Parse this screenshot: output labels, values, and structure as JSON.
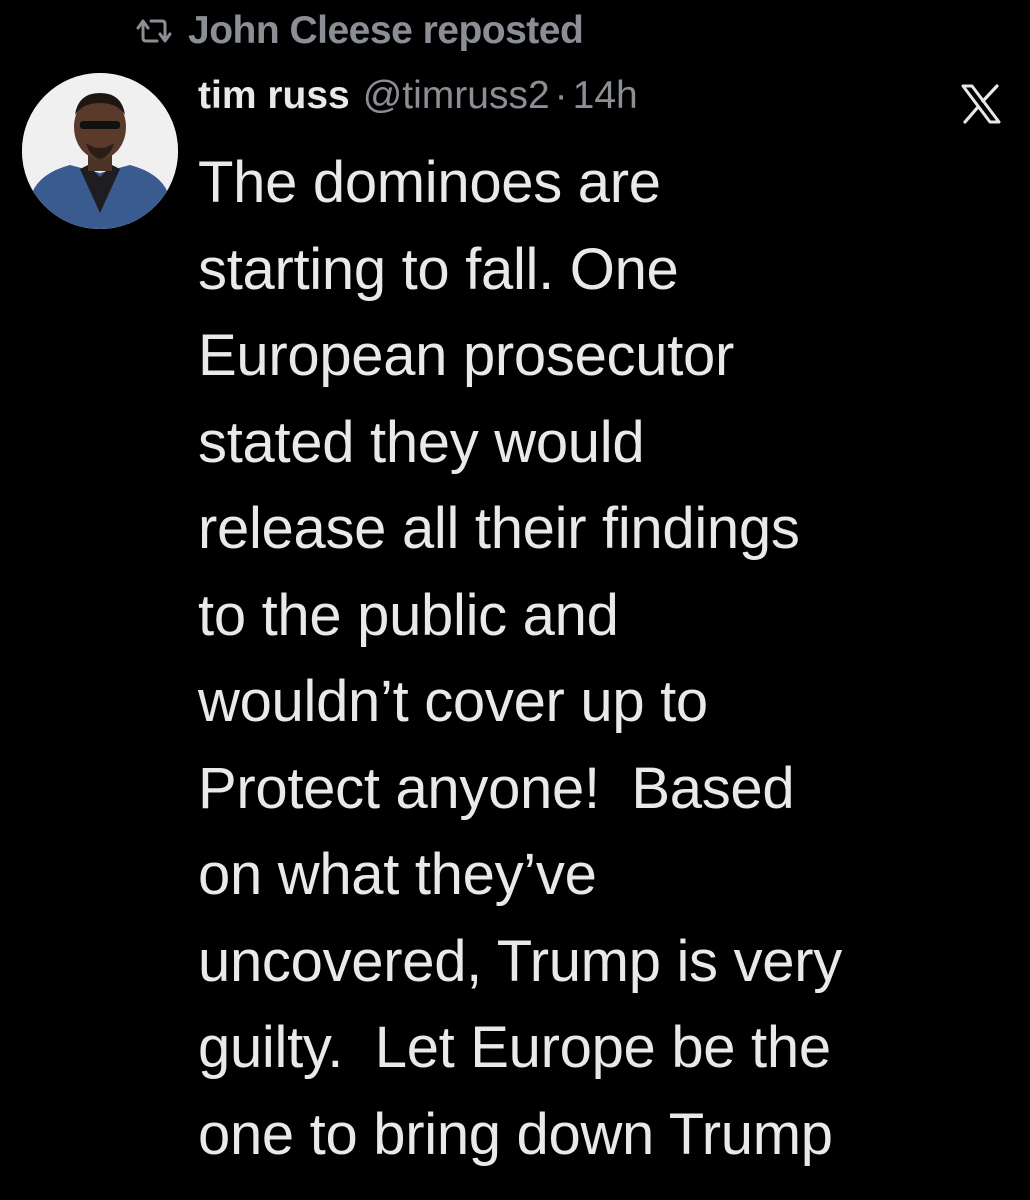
{
  "repost_banner": {
    "icon": "repost-icon",
    "text": "John Cleese reposted"
  },
  "post": {
    "avatar_icon": "user-avatar",
    "author_name": "tim russ",
    "author_handle": "@timruss2",
    "separator": "·",
    "timestamp": "14h",
    "platform_icon": "x-logo-icon",
    "body_lines": [
      "The dominoes are",
      "starting to fall. One",
      "European prosecutor",
      "stated they would",
      "release all their findings",
      "to the public and",
      "wouldn’t cover up to",
      "Protect anyone!  Based",
      "on what they’ve",
      "uncovered, Trump is very",
      "guilty.  Let Europe be the",
      "one to bring down Trump"
    ]
  },
  "colors": {
    "background": "#000000",
    "text_primary": "#e7e9ea",
    "text_secondary": "#8b8f95"
  }
}
